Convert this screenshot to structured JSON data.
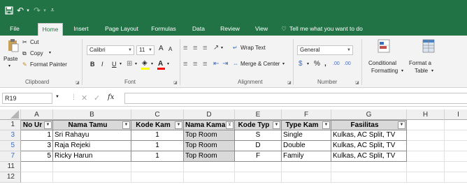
{
  "quick_access": {
    "save_icon": "save-icon",
    "undo_icon": "undo-icon",
    "redo_icon": "redo-icon",
    "customize_icon": "customize-icon"
  },
  "tabs": [
    {
      "label": "File",
      "active": false
    },
    {
      "label": "Home",
      "active": true
    },
    {
      "label": "Insert",
      "active": false
    },
    {
      "label": "Page Layout",
      "active": false
    },
    {
      "label": "Formulas",
      "active": false
    },
    {
      "label": "Data",
      "active": false
    },
    {
      "label": "Review",
      "active": false
    },
    {
      "label": "View",
      "active": false
    }
  ],
  "tell_me": "Tell me what you want to do",
  "clipboard": {
    "paste": "Paste",
    "cut": "Cut",
    "copy": "Copy",
    "format_painter": "Format Painter",
    "group": "Clipboard"
  },
  "font": {
    "name": "Calibri",
    "size": "11",
    "bold": "B",
    "italic": "I",
    "underline": "U",
    "grow": "A",
    "shrink": "A",
    "group": "Font"
  },
  "alignment": {
    "wrap_text": "Wrap Text",
    "merge_center": "Merge & Center",
    "group": "Alignment"
  },
  "number": {
    "format": "General",
    "percent": "%",
    "comma": ",",
    "increase_decimal": ".00",
    "decrease_decimal": ".00",
    "group": "Number"
  },
  "styles": {
    "conditional_1": "Conditional",
    "conditional_2": "Formatting",
    "format_as_1": "Format a",
    "format_as_2": "Table"
  },
  "formula_bar": {
    "cell_ref": "R19",
    "fx": "fx",
    "value": ""
  },
  "columns": [
    "A",
    "B",
    "C",
    "D",
    "E",
    "F",
    "G",
    "H",
    "I"
  ],
  "header_row_num": "1",
  "headers": [
    "No Ur",
    "Nama Tamu",
    "Kode Kam",
    "Nama Kama",
    "Kode Typ",
    "Type Kam",
    "Fasilitas"
  ],
  "rows": [
    {
      "row": "3",
      "cells": [
        "1",
        "Sri Rahayu",
        "1",
        "Top Room",
        "S",
        "Single",
        "Kulkas, AC Split, TV"
      ]
    },
    {
      "row": "5",
      "cells": [
        "3",
        "Raja Rejeki",
        "1",
        "Top Room",
        "D",
        "Double",
        "Kulkas, AC Split, TV"
      ]
    },
    {
      "row": "7",
      "cells": [
        "5",
        "Ricky Harun",
        "1",
        "Top Room",
        "F",
        "Family",
        "Kulkas, AC Split, TV"
      ]
    }
  ],
  "empty_rows": [
    "11",
    "12"
  ],
  "colors": {
    "brand": "#217346",
    "filtered_row": "#3c6ebf",
    "header_fill": "#d9d9d9"
  }
}
